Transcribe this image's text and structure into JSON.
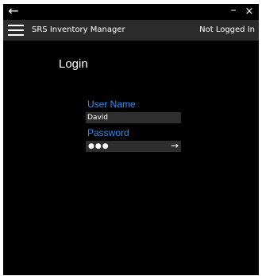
{
  "titlebar": {
    "back_glyph": "←",
    "minimize_glyph": "–",
    "close_glyph": "×"
  },
  "header": {
    "app_title": "SRS Inventory Manager",
    "status": "Not Logged In"
  },
  "main": {
    "page_title": "Login",
    "username": {
      "label": "User Name",
      "value": "David"
    },
    "password": {
      "label": "Password",
      "masked_value": "●●●",
      "submit_glyph": "→"
    }
  },
  "colors": {
    "background": "#000000",
    "appbar": "#2b2b2b",
    "accent": "#1e90ff",
    "field_background": "#2e2e2e"
  },
  "icons": [
    "back-arrow-icon",
    "minimize-icon",
    "close-icon",
    "hamburger-menu-icon",
    "submit-arrow-icon"
  ]
}
